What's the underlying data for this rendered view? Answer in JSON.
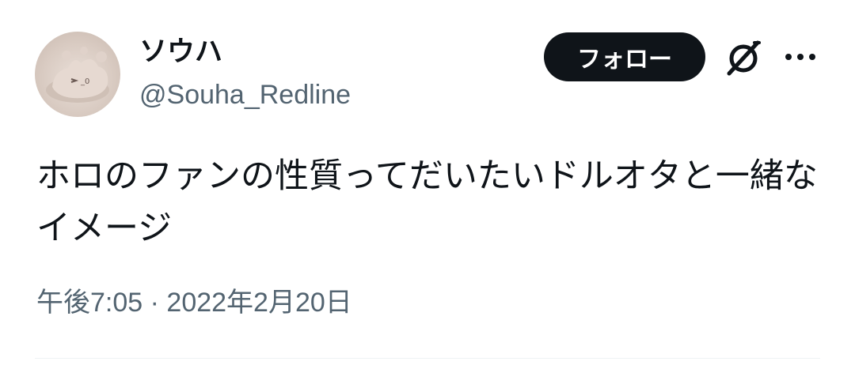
{
  "author": {
    "display_name": "ソウハ",
    "handle": "@Souha_Redline",
    "avatar": "avatar-image"
  },
  "actions": {
    "follow_label": "フォロー",
    "grok_icon": "grok-icon",
    "more_icon": "more-icon"
  },
  "tweet": {
    "text": "ホロのファンの性質ってだいたいドルオタと一緒なイメージ",
    "time": "午後7:05",
    "separator": " · ",
    "date": "2022年2月20日"
  },
  "colors": {
    "text_primary": "#0f1419",
    "text_secondary": "#536471",
    "button_bg": "#0f1419",
    "divider": "#eff3f4"
  }
}
